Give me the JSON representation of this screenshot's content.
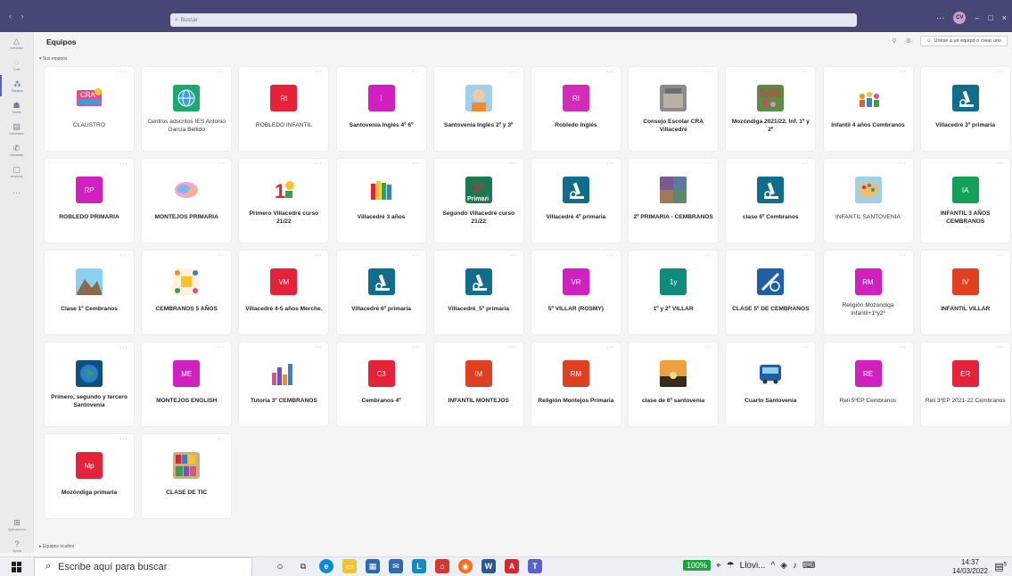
{
  "titlebar": {
    "nav": "‹ ›",
    "search_placeholder": "Buscar",
    "avatar_initials": "CV",
    "min": "–",
    "more": "···",
    "restore": "□",
    "close": "×"
  },
  "rail": {
    "items": [
      {
        "label": "Actividad",
        "icon": "bell-icon"
      },
      {
        "label": "Chat",
        "icon": "chat-icon"
      },
      {
        "label": "Equipos",
        "icon": "teams-icon",
        "active": true
      },
      {
        "label": "Tareas",
        "icon": "backpack-icon"
      },
      {
        "label": "Calendario",
        "icon": "calendar-icon"
      },
      {
        "label": "Llamadas",
        "icon": "phone-icon"
      },
      {
        "label": "Archivos",
        "icon": "file-icon"
      },
      {
        "label": "...",
        "icon": "more-icon"
      }
    ],
    "bottom": [
      {
        "label": "Aplicaciones",
        "icon": "apps-icon"
      },
      {
        "label": "Ayuda",
        "icon": "help-icon"
      }
    ]
  },
  "header": {
    "title": "Equipos",
    "join_label": "Unirse a un equipo o crear uno"
  },
  "sections": {
    "my_teams": "▾ Sus equipos",
    "hidden_teams": "▸ Equipos ocultos"
  },
  "colors": {
    "brand": "#464775",
    "accent": "#5b5fc7"
  },
  "teams": [
    {
      "name": "CLAUSTRO",
      "bold": false,
      "type": "pic",
      "pic": "claustro"
    },
    {
      "name": "Centros adscritos IES Antonio García Bellido",
      "bold": false,
      "type": "pic",
      "pic": "globe"
    },
    {
      "name": "ROBLEDO INFANTIL",
      "bold": false,
      "type": "init",
      "initials": "RI",
      "color": "#e5223a"
    },
    {
      "name": "Santovenia Inglés 4º 6º",
      "bold": true,
      "type": "init",
      "initials": "I",
      "color": "#d11fc0"
    },
    {
      "name": "Santovenia Inglés 2º y 3º",
      "bold": true,
      "type": "pic",
      "pic": "person"
    },
    {
      "name": "Robledo Inglés",
      "bold": true,
      "type": "init",
      "initials": "RI",
      "color": "#d42bb8"
    },
    {
      "name": "Consejo Escolar CRA Villacedré",
      "bold": true,
      "type": "pic",
      "pic": "bldg"
    },
    {
      "name": "Mozóndiga 2021/22. Inf. 1º y 2º",
      "bold": true,
      "type": "pic",
      "pic": "classroom"
    },
    {
      "name": "Infantil 4 años Cembranos",
      "bold": true,
      "type": "pic",
      "pic": "kids"
    },
    {
      "name": "Villacedré 3º primaria",
      "bold": true,
      "type": "pic",
      "pic": "micro"
    },
    {
      "name": "ROBLEDO PRIMARIA",
      "bold": true,
      "type": "init",
      "initials": "RP",
      "color": "#d21fc0"
    },
    {
      "name": "MONTEJOS PRIMARIA",
      "bold": true,
      "type": "pic",
      "pic": "speech"
    },
    {
      "name": "Primero Villacedré curso 21/22",
      "bold": true,
      "type": "pic",
      "pic": "one"
    },
    {
      "name": "Villacedré 3 años",
      "bold": true,
      "type": "pic",
      "pic": "books"
    },
    {
      "name": "Segundo Villacedré curso 21/22",
      "bold": true,
      "type": "pic",
      "pic": "two"
    },
    {
      "name": "Villacedré 4º primaria",
      "bold": true,
      "type": "pic",
      "pic": "micro"
    },
    {
      "name": "2º PRIMARIA - CEMBRANOS",
      "bold": true,
      "type": "pic",
      "pic": "mosaic"
    },
    {
      "name": "clase 6º Cembranos",
      "bold": true,
      "type": "pic",
      "pic": "micro"
    },
    {
      "name": "INFANTIL SANTOVENIA",
      "bold": false,
      "type": "pic",
      "pic": "palette"
    },
    {
      "name": "INFANTIL 3 AÑOS CEMBRANOS",
      "bold": true,
      "type": "init",
      "initials": "IA",
      "color": "#13a05a"
    },
    {
      "name": "Clase 1º Cembranos",
      "bold": true,
      "type": "pic",
      "pic": "mountain"
    },
    {
      "name": "CEMBRANOS 5 AÑOS",
      "bold": true,
      "type": "pic",
      "pic": "frame"
    },
    {
      "name": "Villacedré 4-5 años Merche.",
      "bold": true,
      "type": "init",
      "initials": "VM",
      "color": "#e5223a"
    },
    {
      "name": "Villacedré 6º primaria",
      "bold": true,
      "type": "pic",
      "pic": "micro"
    },
    {
      "name": "Villacedré_5º primaria",
      "bold": true,
      "type": "pic",
      "pic": "micro"
    },
    {
      "name": "5º VILLAR (ROSMY)",
      "bold": true,
      "type": "init",
      "initials": "VR",
      "color": "#d21fc0"
    },
    {
      "name": "1º y 2º VILLAR",
      "bold": true,
      "type": "init",
      "initials": "1y",
      "color": "#108a7b"
    },
    {
      "name": "CLASE 5º DE CEMBRANOS",
      "bold": true,
      "type": "pic",
      "pic": "ruler"
    },
    {
      "name": "Religión Mozondiga Infantil+1ºy2º",
      "bold": false,
      "type": "init",
      "initials": "RM",
      "color": "#d21fc0"
    },
    {
      "name": "INFANTIL VILLAR",
      "bold": true,
      "type": "init",
      "initials": "IV",
      "color": "#e0401f"
    },
    {
      "name": "Primero, segundo y tercero Santovenia",
      "bold": true,
      "type": "pic",
      "pic": "earth"
    },
    {
      "name": "MONTEJOS ENGLISH",
      "bold": true,
      "type": "init",
      "initials": "ME",
      "color": "#d21fc0"
    },
    {
      "name": "Tutoría 3º CEMBRANOS",
      "bold": true,
      "type": "pic",
      "pic": "barchart"
    },
    {
      "name": "Cembranos 4º",
      "bold": true,
      "type": "init",
      "initials": "C3",
      "color": "#e5223a"
    },
    {
      "name": "INFANTIL MONTEJOS",
      "bold": true,
      "type": "init",
      "initials": "IM",
      "color": "#e0401f"
    },
    {
      "name": "Religión Montejos Primaria",
      "bold": true,
      "type": "init",
      "initials": "RM",
      "color": "#e0401f"
    },
    {
      "name": "clase de 6º santovenia",
      "bold": true,
      "type": "pic",
      "pic": "sunset"
    },
    {
      "name": "Cuarto Santovenia",
      "bold": true,
      "type": "pic",
      "pic": "bus"
    },
    {
      "name": "Reli 5ºEP Cembranos",
      "bold": false,
      "type": "init",
      "initials": "RE",
      "color": "#d21fc0"
    },
    {
      "name": "Reli 3ºEP 2021-22 Cembranos",
      "bold": false,
      "type": "init",
      "initials": "ER",
      "color": "#e5223a"
    },
    {
      "name": "Mozóndiga primaria",
      "bold": true,
      "type": "init",
      "initials": "Mp",
      "color": "#e5223a"
    },
    {
      "name": "CLASE DE TIC",
      "bold": true,
      "type": "pic",
      "pic": "shelves"
    }
  ],
  "taskbar": {
    "search_placeholder": "Escribe aquí para buscar",
    "battery": "100%",
    "weather": "Llovi...",
    "time": "14:37",
    "date": "14/03/2022",
    "notification_count": "5"
  }
}
